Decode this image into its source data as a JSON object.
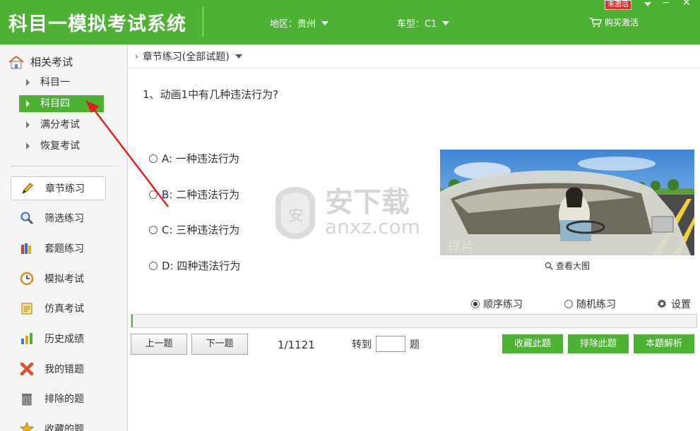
{
  "header": {
    "app_title": "科目一模拟考试系统",
    "region_label": "地区：贵州",
    "vehicle_label": "车型：C1",
    "buy_label": "购买激活",
    "unactivated_badge": "未激活",
    "window_controls": {
      "minimize": "−",
      "close": "✕"
    },
    "accent": "#4db133"
  },
  "sidebar": {
    "related_label": "相关考试",
    "sub_items": [
      {
        "label": "科目一",
        "active": false
      },
      {
        "label": "科目四",
        "active": true
      },
      {
        "label": "满分考试",
        "active": false
      },
      {
        "label": "恢复考试",
        "active": false
      }
    ],
    "nav_items": [
      {
        "label": "章节练习",
        "icon": "pencil-icon",
        "active": true
      },
      {
        "label": "筛选练习",
        "icon": "magnifier-icon",
        "active": false
      },
      {
        "label": "套题练习",
        "icon": "books-icon",
        "active": false
      },
      {
        "label": "模拟考试",
        "icon": "clock-icon",
        "active": false
      },
      {
        "label": "仿真考试",
        "icon": "notepad-icon",
        "active": false
      },
      {
        "label": "历史成绩",
        "icon": "bar-chart-icon",
        "active": false
      },
      {
        "label": "我的错题",
        "icon": "red-x-icon",
        "active": false
      },
      {
        "label": "排除的题",
        "icon": "trash-can-icon",
        "active": false
      },
      {
        "label": "收藏的题",
        "icon": "star-icon",
        "active": false
      }
    ]
  },
  "main": {
    "breadcrumb": "章节练习(全部试题)",
    "question": "1、动画1中有几种违法行为?",
    "options": [
      {
        "label": "A: 一种违法行为"
      },
      {
        "label": "B: 二种违法行为"
      },
      {
        "label": "C: 三种违法行为"
      },
      {
        "label": "D: 四种违法行为"
      }
    ],
    "view_large_label": "查看大图",
    "picture_watermark": "样片",
    "site_watermark": {
      "line1": "安下载",
      "line2": "anxz.com",
      "badge": "安"
    },
    "modes": {
      "sequential": "顺序练习",
      "random": "随机练习",
      "settings": "设置",
      "selected": "sequential"
    },
    "progress_fraction": 0.001,
    "buttons": {
      "prev": "上一题",
      "next": "下一题",
      "favorite": "收藏此题",
      "exclude": "排除此题",
      "explain": "本题解析"
    },
    "counter": "1/1121",
    "goto_prefix": "转到",
    "goto_suffix": "题",
    "goto_value": ""
  }
}
